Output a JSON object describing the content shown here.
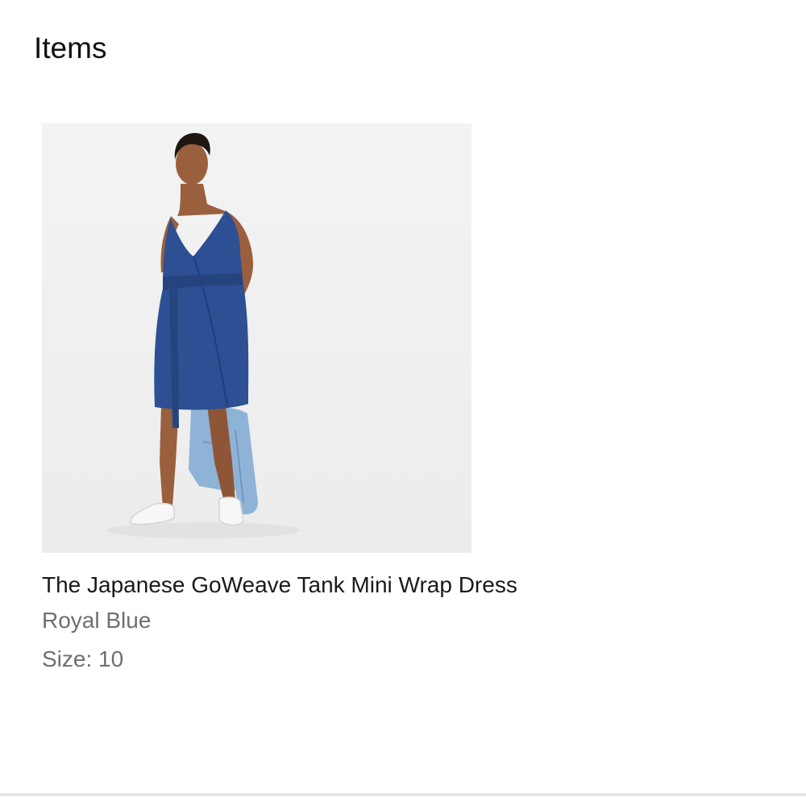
{
  "section": {
    "title": "Items"
  },
  "item": {
    "name": "The Japanese GoWeave Tank Mini Wrap Dress",
    "color": "Royal Blue",
    "size": "Size: 10"
  },
  "colors": {
    "title_text": "#111111",
    "name_text": "#1a1a1a",
    "secondary_text": "#6f6f6f",
    "dress": "#2d4f93",
    "divider": "#e4e4e4"
  }
}
